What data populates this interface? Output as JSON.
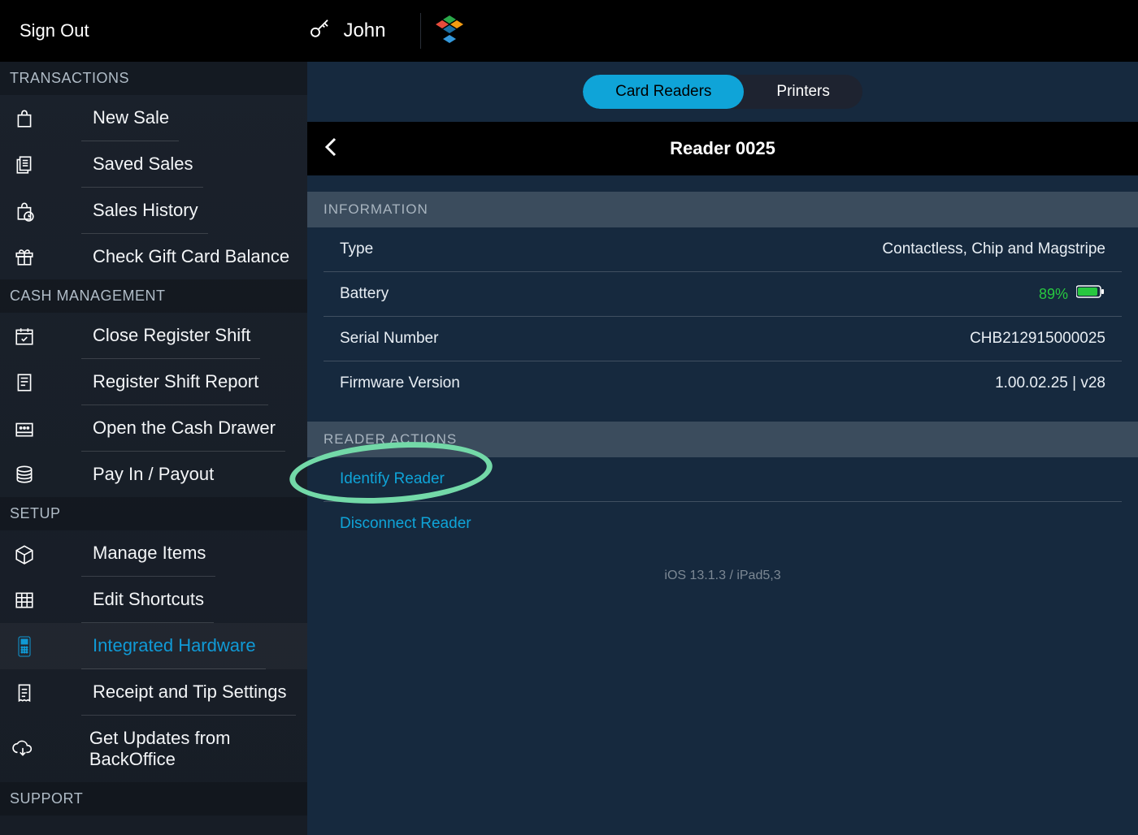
{
  "header": {
    "signout": "Sign Out",
    "user": "John"
  },
  "sidebar": {
    "sections": {
      "transactions": "TRANSACTIONS",
      "cash": "CASH MANAGEMENT",
      "setup": "SETUP",
      "support": "SUPPORT"
    },
    "transactions": [
      "New Sale",
      "Saved Sales",
      "Sales History",
      "Check Gift Card Balance"
    ],
    "cash": [
      "Close Register Shift",
      "Register Shift Report",
      "Open the Cash Drawer",
      "Pay In / Payout"
    ],
    "setup": [
      "Manage Items",
      "Edit Shortcuts",
      "Integrated Hardware",
      "Receipt and Tip Settings",
      "Get Updates from BackOffice"
    ]
  },
  "tabs": {
    "card_readers": "Card Readers",
    "printers": "Printers"
  },
  "detail": {
    "title": "Reader 0025",
    "section_info": "INFORMATION",
    "section_actions": "READER ACTIONS",
    "rows": {
      "type_label": "Type",
      "type_value": "Contactless, Chip and Magstripe",
      "battery_label": "Battery",
      "battery_value": "89%",
      "serial_label": "Serial Number",
      "serial_value": "CHB212915000025",
      "firmware_label": "Firmware Version",
      "firmware_value": "1.00.02.25 | v28"
    },
    "actions": {
      "identify": "Identify Reader",
      "disconnect": "Disconnect Reader"
    },
    "device_info": "iOS 13.1.3 / iPad5,3"
  }
}
